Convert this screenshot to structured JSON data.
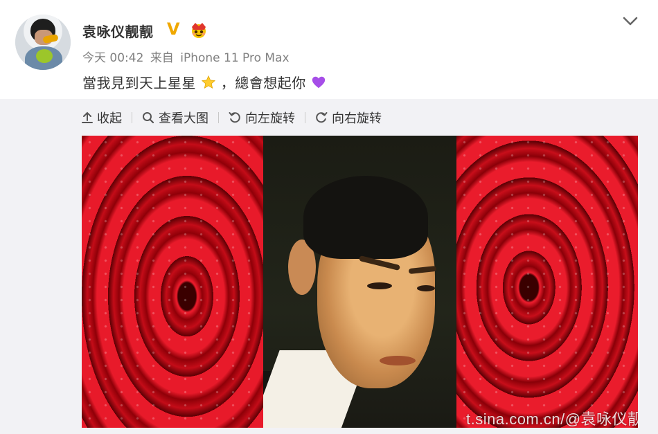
{
  "post": {
    "author": "袁咏仪靓靓",
    "verified_badge": "V",
    "member_icon": "crown-member-icon",
    "time": "今天 00:42",
    "source_prefix": "来自",
    "source": "iPhone 11 Pro Max",
    "text_part1": "當我見到天上星星",
    "text_part2": "，總會想起你",
    "emoji_star": "star-emoji",
    "emoji_heart": "purple-heart-emoji"
  },
  "toolbar": {
    "collapse": "收起",
    "view_large": "查看大图",
    "rotate_left": "向左旋转",
    "rotate_right": "向右旋转"
  },
  "image": {
    "watermark": "t.sina.com.cn/@袁咏仪靓靓"
  },
  "colors": {
    "badge_gold": "#f0a800",
    "text_primary": "#333333",
    "text_secondary": "#808080",
    "media_bg": "#f2f2f5"
  }
}
